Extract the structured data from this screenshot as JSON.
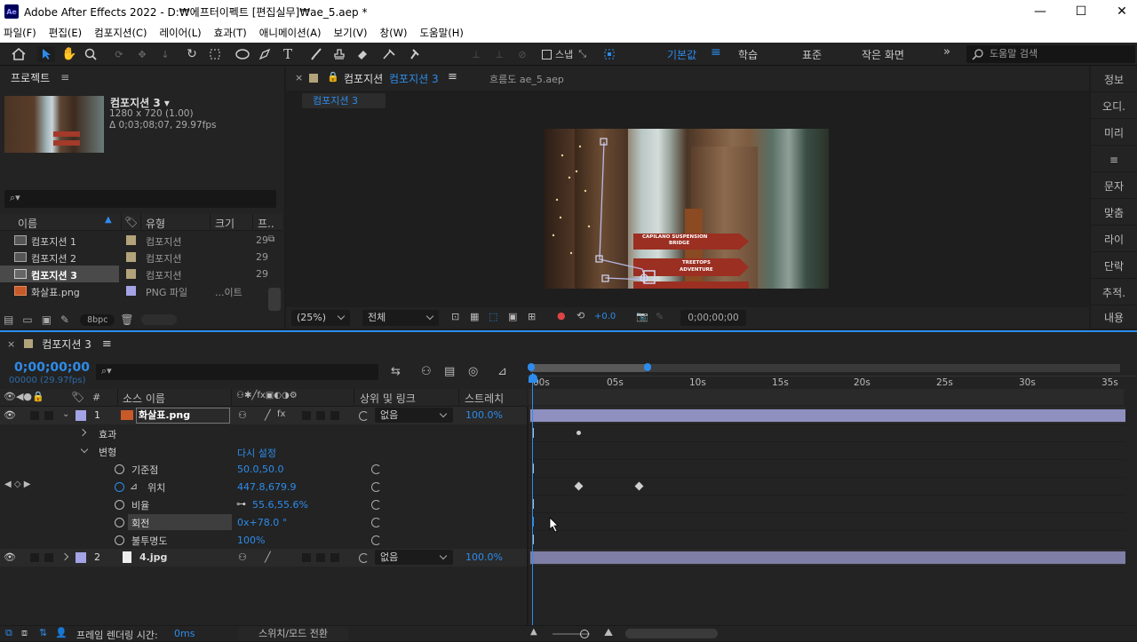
{
  "window": {
    "app_icon": "Ae",
    "title": "Adobe After Effects 2022 - D:₩에프터이펙트 [편집실무]₩ae_5.aep *"
  },
  "menu": [
    "파일(F)",
    "편집(E)",
    "컴포지션(C)",
    "레이어(L)",
    "효과(T)",
    "애니메이션(A)",
    "보기(V)",
    "창(W)",
    "도움말(H)"
  ],
  "toolbar": {
    "snap_label": "스냅",
    "workspaces": [
      "기본값",
      "학습",
      "표준",
      "작은 화면"
    ],
    "help_placeholder": "도움말 검색"
  },
  "project": {
    "tab": "프로젝트",
    "comp_name": "컴포지션 3 ▾",
    "comp_info1": "1280 x 720 (1.00)",
    "comp_info2": "Δ 0;03;08;07, 29.97fps",
    "columns": [
      "이름",
      "유형",
      "크기",
      "프.."
    ],
    "items": [
      {
        "name": "컴포지션 1",
        "type": "컴포지션",
        "size": "29",
        "color": "#b3a37a"
      },
      {
        "name": "컴포지션 2",
        "type": "컴포지션",
        "size": "29",
        "color": "#b3a37a"
      },
      {
        "name": "컴포지션 3",
        "type": "컴포지션",
        "size": "29",
        "color": "#b3a37a"
      },
      {
        "name": "화살표.png",
        "type": "PNG 파일",
        "size": "...이트",
        "color": "#a3a3e6"
      }
    ],
    "bpc": "8bpc"
  },
  "viewer": {
    "tab_prefix": "컴포지션",
    "tab_comp": "컴포지션 3",
    "tab2": "흐름도 ae_5.aep",
    "breadcrumb": "컴포지션 3",
    "zoom": "(25%)",
    "resolution": "전체",
    "exposure": "+0.0",
    "timecode": "0;00;00;00",
    "sign1a": "CAPILANO SUSPENSION",
    "sign1b": "BRIDGE",
    "sign2a": "TREETOPS",
    "sign2b": "ADVENTURE"
  },
  "right_panels": [
    "정보",
    "오디.",
    "미리",
    "≡",
    "문자",
    "맞춤",
    "라이",
    "단락",
    "추적.",
    "내용"
  ],
  "timeline": {
    "tab": "컴포지션 3",
    "timecode": "0;00;00;00",
    "fps": "00000 (29.97fps)",
    "col_source": "소스 이름",
    "col_parent": "상위 및 링크",
    "col_stretch": "스트레치",
    "ruler": [
      "00s",
      "05s",
      "10s",
      "15s",
      "20s",
      "25s",
      "30s",
      "35s"
    ],
    "layer1": {
      "num": "1",
      "name": "화살표.png",
      "parent": "없음",
      "stretch": "100.0%"
    },
    "effects": "효과",
    "transform": "변형",
    "reset": "다시 설정",
    "props": [
      {
        "name": "기준점",
        "value": "50.0,50.0"
      },
      {
        "name": "위치",
        "value": "447.8,679.9"
      },
      {
        "name": "비율",
        "value": "55.6,55.6%"
      },
      {
        "name": "회전",
        "value": "0x+78.0 °"
      },
      {
        "name": "불투명도",
        "value": "100%"
      }
    ],
    "layer2": {
      "num": "2",
      "name": "4.jpg",
      "parent": "없음",
      "stretch": "100.0%"
    },
    "footer_render": "프레임 렌더링 시간:",
    "footer_ms": "0ms",
    "footer_toggle": "스위치/모드 전환"
  }
}
